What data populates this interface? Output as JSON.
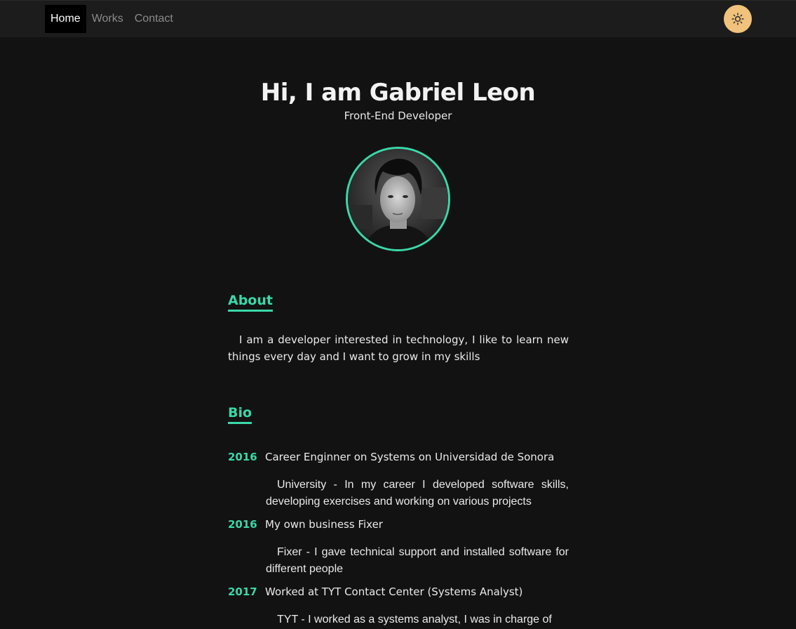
{
  "nav": {
    "items": [
      {
        "label": "Home",
        "active": true
      },
      {
        "label": "Works",
        "active": false
      },
      {
        "label": "Contact",
        "active": false
      }
    ],
    "theme_toggle_icon": "sun-icon"
  },
  "hero": {
    "title": "Hi, I am Gabriel Leon",
    "subtitle": "Front-End Developer"
  },
  "about": {
    "heading": "About",
    "text": "I am a developer interested in technology, I like to learn new things every day and I want to grow in my skills"
  },
  "bio": {
    "heading": "Bio",
    "entries": [
      {
        "year": "2016",
        "title": "Career Enginner on Systems on Universidad de Sonora",
        "description": "University - In my career I developed software skills, developing exercises and working on various projects"
      },
      {
        "year": "2016",
        "title": "My own business Fixer",
        "description": "Fixer - I gave technical support and installed software for different people"
      },
      {
        "year": "2017",
        "title": "Worked at TYT Contact Center (Systems Analyst)",
        "description": "TYT - I worked as a systems analyst, I was in charge of"
      }
    ]
  },
  "colors": {
    "accent": "#3ad8a8",
    "background": "#121212",
    "navbar": "#1c1c1c",
    "toggle": "#f0c27b"
  }
}
